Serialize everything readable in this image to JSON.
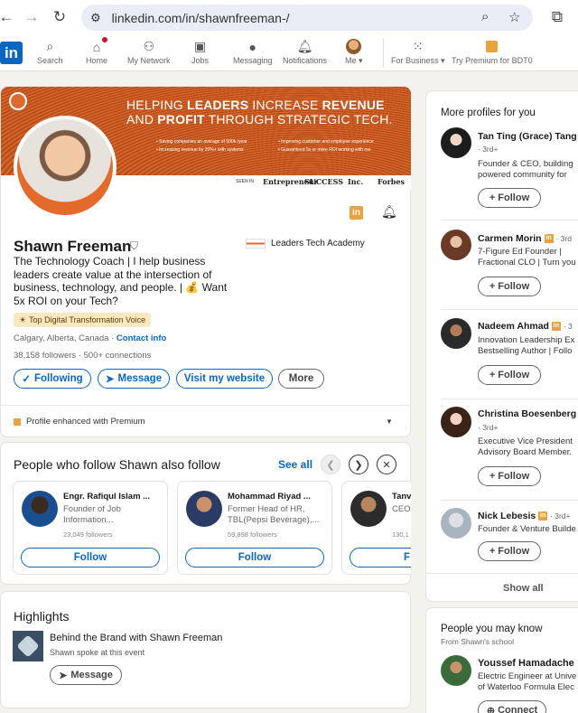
{
  "browser": {
    "url": "linkedin.com/in/shawnfreeman-/"
  },
  "nav": {
    "logo": "in",
    "items": [
      {
        "label": "Search",
        "icon": "search-icon"
      },
      {
        "label": "Home",
        "icon": "home-icon"
      },
      {
        "label": "My Network",
        "icon": "network-icon"
      },
      {
        "label": "Jobs",
        "icon": "jobs-icon"
      },
      {
        "label": "Messaging",
        "icon": "messaging-icon"
      },
      {
        "label": "Notifications",
        "icon": "bell-icon"
      },
      {
        "label": "Me",
        "icon": "avatar"
      },
      {
        "label": "For Business",
        "icon": "grid-icon"
      },
      {
        "label": "Try Premium for BDT0",
        "icon": "premium-icon"
      }
    ]
  },
  "banner": {
    "line1_a": "HELPING ",
    "line1_b": "LEADERS",
    "line1_c": " INCREASE ",
    "line1_d": "REVENUE",
    "line2_a": "AND ",
    "line2_b": "PROFIT",
    "line2_c": " THROUGH STRATEGIC TECH.",
    "bullets": [
      "• Saving companies an average of 500k /year",
      "• Increasing revenue by 20%+ with systems",
      "• Improving customer and employee experience",
      "• Guaranteed 5x or more ROI working with me"
    ],
    "seen_in": "SEEN IN",
    "logos": [
      "Entrepreneur",
      "SUCCESS",
      "Inc.",
      "Forbes"
    ]
  },
  "profile": {
    "name": "Shawn Freeman",
    "headline": "The Technology Coach | I help business leaders create value at the intersection of business, technology, and people. | 💰 Want 5x ROI on your Tech?",
    "education": "Leaders Tech Academy",
    "voice_badge": "Top Digital Transformation Voice",
    "location": "Calgary, Alberta, Canada",
    "contact_info": "Contact info",
    "followers": "38,158 followers",
    "connections": "500+ connections",
    "buttons": {
      "following": "Following",
      "message": "Message",
      "website": "Visit my website",
      "more": "More"
    },
    "premium_row": "Profile enhanced with Premium"
  },
  "also_follow": {
    "title": "People who follow Shawn also follow",
    "see_all": "See all",
    "people": [
      {
        "name": "Engr. Rafiqul Islam ...",
        "desc1": "Founder of Job",
        "desc2": "Information...",
        "followers": "23,049 followers",
        "button": "Follow"
      },
      {
        "name": "Mohammad Riyad ...",
        "desc1": "Former Head of HR,",
        "desc2": "TBL(Pepsi Beverage),...",
        "followers": "59,898 followers",
        "button": "Follow"
      },
      {
        "name": "Tanv",
        "desc1": "CEO",
        "desc2": "",
        "followers": "130,1",
        "button": "F"
      }
    ]
  },
  "highlights": {
    "title": "Highlights",
    "item_title": "Behind the Brand with Shawn Freeman",
    "item_sub": "Shawn spoke at this event",
    "button": "Message"
  },
  "more_profiles": {
    "title": "More profiles for you",
    "people": [
      {
        "name": "Tan Ting (Grace) Tang",
        "meta": "· 3rd+",
        "desc1": "Founder & CEO, building",
        "desc2": "powered community for",
        "button": "Follow"
      },
      {
        "name": "Carmen Morin",
        "meta": "· 3rd",
        "desc1": "7-Figure Ed Founder |",
        "desc2": "Fractional CLO | Turn you",
        "button": "Follow"
      },
      {
        "name": "Nadeem Ahmad",
        "meta": "· 3",
        "desc1": "Innovation Leadership Ex",
        "desc2": "Bestselling Author | Follo",
        "button": "Follow"
      },
      {
        "name": "Christina Boesenberg",
        "meta": "· 3rd+",
        "desc1": "Executive Vice President",
        "desc2": "Advisory Board Member.",
        "button": "Follow"
      },
      {
        "name": "Nick Lebesis",
        "meta": "· 3rd+",
        "desc1": "Founder & Venture Builde",
        "desc2": "",
        "button": "Follow"
      }
    ],
    "show_all": "Show all"
  },
  "may_know": {
    "title": "People you may know",
    "subtitle": "From Shawn's school",
    "person": {
      "name": "Youssef Hamadache",
      "desc1": "Electric Engineer at Unive",
      "desc2": "of Waterloo Formula Elec",
      "button": "Connect"
    }
  }
}
